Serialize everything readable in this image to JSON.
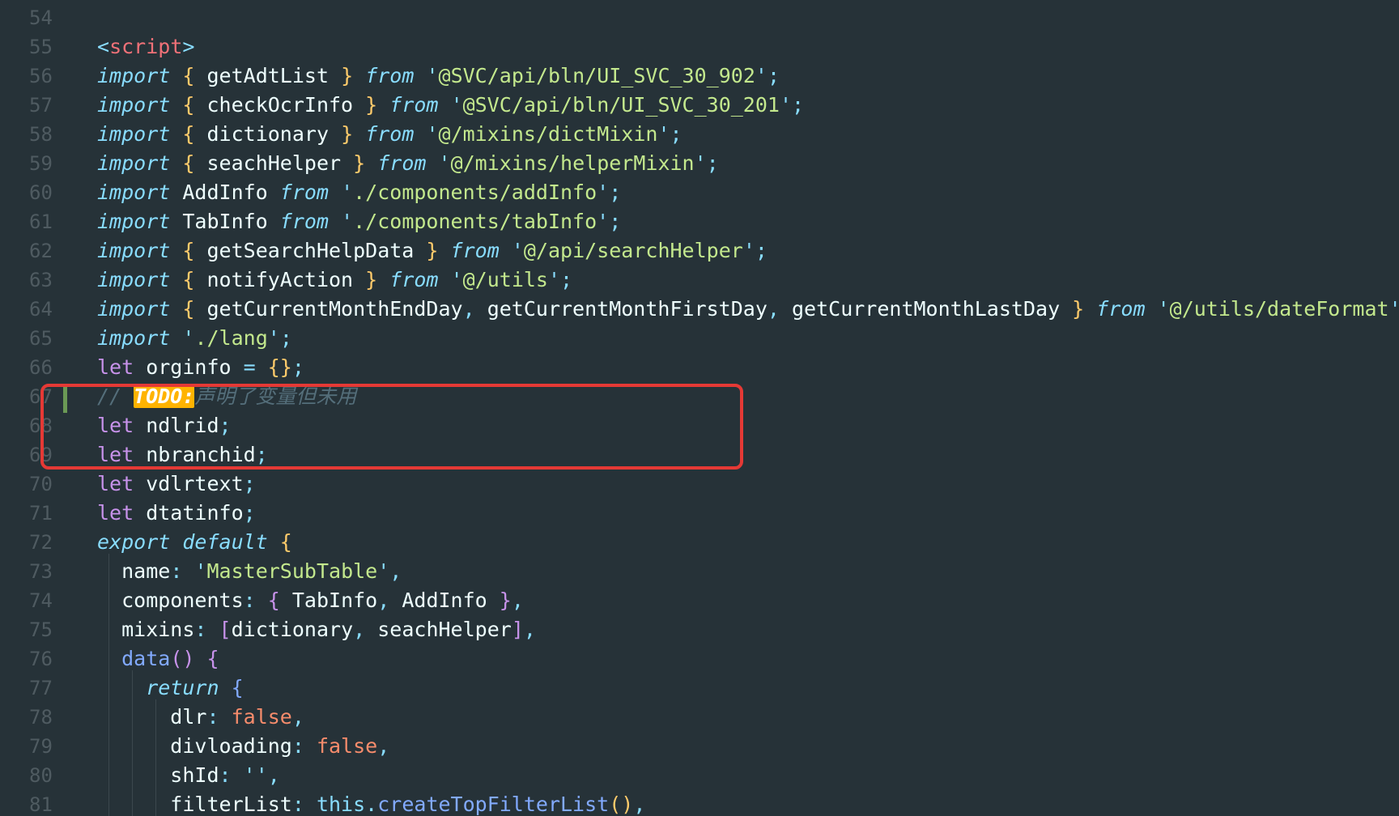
{
  "editor": {
    "lines": [
      {
        "n": "54",
        "tokens": []
      },
      {
        "n": "55",
        "tokens": [
          {
            "t": "<",
            "c": "tok-tagbr"
          },
          {
            "t": "script",
            "c": "tok-tag"
          },
          {
            "t": ">",
            "c": "tok-tagbr"
          }
        ]
      },
      {
        "n": "56",
        "tokens": [
          {
            "t": "import",
            "c": "tok-kw-italic"
          },
          {
            "t": " ",
            "c": ""
          },
          {
            "t": "{",
            "c": "tok-brace"
          },
          {
            "t": " getAdtList ",
            "c": "tok-ident"
          },
          {
            "t": "}",
            "c": "tok-brace"
          },
          {
            "t": " ",
            "c": ""
          },
          {
            "t": "from",
            "c": "tok-kw-italic"
          },
          {
            "t": " ",
            "c": ""
          },
          {
            "t": "'",
            "c": "tok-punct"
          },
          {
            "t": "@SVC/api/bln/UI_SVC_30_902",
            "c": "tok-str"
          },
          {
            "t": "'",
            "c": "tok-punct"
          },
          {
            "t": ";",
            "c": "tok-punct"
          }
        ]
      },
      {
        "n": "57",
        "tokens": [
          {
            "t": "import",
            "c": "tok-kw-italic"
          },
          {
            "t": " ",
            "c": ""
          },
          {
            "t": "{",
            "c": "tok-brace"
          },
          {
            "t": " checkOcrInfo ",
            "c": "tok-ident"
          },
          {
            "t": "}",
            "c": "tok-brace"
          },
          {
            "t": " ",
            "c": ""
          },
          {
            "t": "from",
            "c": "tok-kw-italic"
          },
          {
            "t": " ",
            "c": ""
          },
          {
            "t": "'",
            "c": "tok-punct"
          },
          {
            "t": "@SVC/api/bln/UI_SVC_30_201",
            "c": "tok-str"
          },
          {
            "t": "'",
            "c": "tok-punct"
          },
          {
            "t": ";",
            "c": "tok-punct"
          }
        ]
      },
      {
        "n": "58",
        "tokens": [
          {
            "t": "import",
            "c": "tok-kw-italic"
          },
          {
            "t": " ",
            "c": ""
          },
          {
            "t": "{",
            "c": "tok-brace"
          },
          {
            "t": " dictionary ",
            "c": "tok-ident"
          },
          {
            "t": "}",
            "c": "tok-brace"
          },
          {
            "t": " ",
            "c": ""
          },
          {
            "t": "from",
            "c": "tok-kw-italic"
          },
          {
            "t": " ",
            "c": ""
          },
          {
            "t": "'",
            "c": "tok-punct"
          },
          {
            "t": "@/mixins/dictMixin",
            "c": "tok-str"
          },
          {
            "t": "'",
            "c": "tok-punct"
          },
          {
            "t": ";",
            "c": "tok-punct"
          }
        ]
      },
      {
        "n": "59",
        "tokens": [
          {
            "t": "import",
            "c": "tok-kw-italic"
          },
          {
            "t": " ",
            "c": ""
          },
          {
            "t": "{",
            "c": "tok-brace"
          },
          {
            "t": " seachHelper ",
            "c": "tok-ident"
          },
          {
            "t": "}",
            "c": "tok-brace"
          },
          {
            "t": " ",
            "c": ""
          },
          {
            "t": "from",
            "c": "tok-kw-italic"
          },
          {
            "t": " ",
            "c": ""
          },
          {
            "t": "'",
            "c": "tok-punct"
          },
          {
            "t": "@/mixins/helperMixin",
            "c": "tok-str"
          },
          {
            "t": "'",
            "c": "tok-punct"
          },
          {
            "t": ";",
            "c": "tok-punct"
          }
        ]
      },
      {
        "n": "60",
        "tokens": [
          {
            "t": "import",
            "c": "tok-kw-italic"
          },
          {
            "t": " AddInfo ",
            "c": "tok-ident"
          },
          {
            "t": "from",
            "c": "tok-kw-italic"
          },
          {
            "t": " ",
            "c": ""
          },
          {
            "t": "'",
            "c": "tok-punct"
          },
          {
            "t": "./components/addInfo",
            "c": "tok-str"
          },
          {
            "t": "'",
            "c": "tok-punct"
          },
          {
            "t": ";",
            "c": "tok-punct"
          }
        ]
      },
      {
        "n": "61",
        "tokens": [
          {
            "t": "import",
            "c": "tok-kw-italic"
          },
          {
            "t": " TabInfo ",
            "c": "tok-ident"
          },
          {
            "t": "from",
            "c": "tok-kw-italic"
          },
          {
            "t": " ",
            "c": ""
          },
          {
            "t": "'",
            "c": "tok-punct"
          },
          {
            "t": "./components/tabInfo",
            "c": "tok-str"
          },
          {
            "t": "'",
            "c": "tok-punct"
          },
          {
            "t": ";",
            "c": "tok-punct"
          }
        ]
      },
      {
        "n": "62",
        "tokens": [
          {
            "t": "import",
            "c": "tok-kw-italic"
          },
          {
            "t": " ",
            "c": ""
          },
          {
            "t": "{",
            "c": "tok-brace"
          },
          {
            "t": " getSearchHelpData ",
            "c": "tok-ident"
          },
          {
            "t": "}",
            "c": "tok-brace"
          },
          {
            "t": " ",
            "c": ""
          },
          {
            "t": "from",
            "c": "tok-kw-italic"
          },
          {
            "t": " ",
            "c": ""
          },
          {
            "t": "'",
            "c": "tok-punct"
          },
          {
            "t": "@/api/searchHelper",
            "c": "tok-str"
          },
          {
            "t": "'",
            "c": "tok-punct"
          },
          {
            "t": ";",
            "c": "tok-punct"
          }
        ]
      },
      {
        "n": "63",
        "tokens": [
          {
            "t": "import",
            "c": "tok-kw-italic"
          },
          {
            "t": " ",
            "c": ""
          },
          {
            "t": "{",
            "c": "tok-brace"
          },
          {
            "t": " notifyAction ",
            "c": "tok-ident"
          },
          {
            "t": "}",
            "c": "tok-brace"
          },
          {
            "t": " ",
            "c": ""
          },
          {
            "t": "from",
            "c": "tok-kw-italic"
          },
          {
            "t": " ",
            "c": ""
          },
          {
            "t": "'",
            "c": "tok-punct"
          },
          {
            "t": "@/utils",
            "c": "tok-str"
          },
          {
            "t": "'",
            "c": "tok-punct"
          },
          {
            "t": ";",
            "c": "tok-punct"
          }
        ]
      },
      {
        "n": "64",
        "tokens": [
          {
            "t": "import",
            "c": "tok-kw-italic"
          },
          {
            "t": " ",
            "c": ""
          },
          {
            "t": "{",
            "c": "tok-brace"
          },
          {
            "t": " getCurrentMonthEndDay",
            "c": "tok-ident"
          },
          {
            "t": ",",
            "c": "tok-punct"
          },
          {
            "t": " getCurrentMonthFirstDay",
            "c": "tok-ident"
          },
          {
            "t": ",",
            "c": "tok-punct"
          },
          {
            "t": " getCurrentMonthLastDay ",
            "c": "tok-ident"
          },
          {
            "t": "}",
            "c": "tok-brace"
          },
          {
            "t": " ",
            "c": ""
          },
          {
            "t": "from",
            "c": "tok-kw-italic"
          },
          {
            "t": " ",
            "c": ""
          },
          {
            "t": "'",
            "c": "tok-punct"
          },
          {
            "t": "@/utils/dateFormat",
            "c": "tok-str"
          },
          {
            "t": "'",
            "c": "tok-punct"
          },
          {
            "t": ";",
            "c": "tok-punct"
          }
        ]
      },
      {
        "n": "65",
        "tokens": [
          {
            "t": "import",
            "c": "tok-kw-italic"
          },
          {
            "t": " ",
            "c": ""
          },
          {
            "t": "'",
            "c": "tok-punct"
          },
          {
            "t": "./lang",
            "c": "tok-str"
          },
          {
            "t": "'",
            "c": "tok-punct"
          },
          {
            "t": ";",
            "c": "tok-punct"
          }
        ]
      },
      {
        "n": "66",
        "tokens": [
          {
            "t": "let",
            "c": "tok-let"
          },
          {
            "t": " orginfo ",
            "c": "tok-ident"
          },
          {
            "t": "=",
            "c": "tok-punct"
          },
          {
            "t": " ",
            "c": ""
          },
          {
            "t": "{}",
            "c": "tok-brace"
          },
          {
            "t": ";",
            "c": "tok-punct"
          }
        ]
      },
      {
        "n": "67",
        "tokens": [
          {
            "t": "// ",
            "c": "tok-cmt"
          },
          {
            "t": "TODO:",
            "c": "tok-todo"
          },
          {
            "t": "声明了变量但未用",
            "c": "tok-cmt"
          }
        ]
      },
      {
        "n": "68",
        "tokens": [
          {
            "t": "let",
            "c": "tok-let"
          },
          {
            "t": " ndlrid",
            "c": "tok-ident"
          },
          {
            "t": ";",
            "c": "tok-punct"
          }
        ]
      },
      {
        "n": "69",
        "tokens": [
          {
            "t": "let",
            "c": "tok-let"
          },
          {
            "t": " nbranchid",
            "c": "tok-ident"
          },
          {
            "t": ";",
            "c": "tok-punct"
          }
        ]
      },
      {
        "n": "70",
        "tokens": [
          {
            "t": "let",
            "c": "tok-let"
          },
          {
            "t": " vdlrtext",
            "c": "tok-ident"
          },
          {
            "t": ";",
            "c": "tok-punct"
          }
        ]
      },
      {
        "n": "71",
        "tokens": [
          {
            "t": "let",
            "c": "tok-let"
          },
          {
            "t": " dtatinfo",
            "c": "tok-ident"
          },
          {
            "t": ";",
            "c": "tok-punct"
          }
        ]
      },
      {
        "n": "72",
        "tokens": [
          {
            "t": "export",
            "c": "tok-kw-italic"
          },
          {
            "t": " ",
            "c": ""
          },
          {
            "t": "default",
            "c": "tok-kw-italic"
          },
          {
            "t": " ",
            "c": ""
          },
          {
            "t": "{",
            "c": "tok-brace"
          }
        ]
      },
      {
        "n": "73",
        "tokens": [
          {
            "t": "  name",
            "c": "tok-prop"
          },
          {
            "t": ":",
            "c": "tok-punct"
          },
          {
            "t": " ",
            "c": ""
          },
          {
            "t": "'",
            "c": "tok-punct"
          },
          {
            "t": "MasterSubTable",
            "c": "tok-str"
          },
          {
            "t": "'",
            "c": "tok-punct"
          },
          {
            "t": ",",
            "c": "tok-punct"
          }
        ]
      },
      {
        "n": "74",
        "tokens": [
          {
            "t": "  components",
            "c": "tok-prop"
          },
          {
            "t": ":",
            "c": "tok-punct"
          },
          {
            "t": " ",
            "c": ""
          },
          {
            "t": "{",
            "c": "tok-brace2"
          },
          {
            "t": " TabInfo",
            "c": "tok-ident"
          },
          {
            "t": ",",
            "c": "tok-punct"
          },
          {
            "t": " AddInfo ",
            "c": "tok-ident"
          },
          {
            "t": "}",
            "c": "tok-brace2"
          },
          {
            "t": ",",
            "c": "tok-punct"
          }
        ]
      },
      {
        "n": "75",
        "tokens": [
          {
            "t": "  mixins",
            "c": "tok-prop"
          },
          {
            "t": ":",
            "c": "tok-punct"
          },
          {
            "t": " ",
            "c": ""
          },
          {
            "t": "[",
            "c": "tok-brace2"
          },
          {
            "t": "dictionary",
            "c": "tok-ident"
          },
          {
            "t": ",",
            "c": "tok-punct"
          },
          {
            "t": " seachHelper",
            "c": "tok-ident"
          },
          {
            "t": "]",
            "c": "tok-brace2"
          },
          {
            "t": ",",
            "c": "tok-punct"
          }
        ]
      },
      {
        "n": "76",
        "tokens": [
          {
            "t": "  ",
            "c": ""
          },
          {
            "t": "data",
            "c": "tok-func"
          },
          {
            "t": "()",
            "c": "tok-brace2"
          },
          {
            "t": " ",
            "c": ""
          },
          {
            "t": "{",
            "c": "tok-brace2"
          }
        ]
      },
      {
        "n": "77",
        "tokens": [
          {
            "t": "    ",
            "c": ""
          },
          {
            "t": "return",
            "c": "tok-kw-italic"
          },
          {
            "t": " ",
            "c": ""
          },
          {
            "t": "{",
            "c": "tok-brace3"
          }
        ]
      },
      {
        "n": "78",
        "tokens": [
          {
            "t": "      dlr",
            "c": "tok-prop"
          },
          {
            "t": ":",
            "c": "tok-punct"
          },
          {
            "t": " ",
            "c": ""
          },
          {
            "t": "false",
            "c": "tok-bool"
          },
          {
            "t": ",",
            "c": "tok-punct"
          }
        ]
      },
      {
        "n": "79",
        "tokens": [
          {
            "t": "      divloading",
            "c": "tok-prop"
          },
          {
            "t": ":",
            "c": "tok-punct"
          },
          {
            "t": " ",
            "c": ""
          },
          {
            "t": "false",
            "c": "tok-bool"
          },
          {
            "t": ",",
            "c": "tok-punct"
          }
        ]
      },
      {
        "n": "80",
        "tokens": [
          {
            "t": "      shId",
            "c": "tok-prop"
          },
          {
            "t": ":",
            "c": "tok-punct"
          },
          {
            "t": " ",
            "c": ""
          },
          {
            "t": "''",
            "c": "tok-punct"
          },
          {
            "t": ",",
            "c": "tok-punct"
          }
        ]
      },
      {
        "n": "81",
        "tokens": [
          {
            "t": "      filterList",
            "c": "tok-prop"
          },
          {
            "t": ":",
            "c": "tok-punct"
          },
          {
            "t": " ",
            "c": ""
          },
          {
            "t": "this",
            "c": "tok-this"
          },
          {
            "t": ".",
            "c": "tok-punct"
          },
          {
            "t": "createTopFilterList",
            "c": "tok-method"
          },
          {
            "t": "()",
            "c": "tok-brace"
          },
          {
            "t": ",",
            "c": "tok-punct"
          }
        ]
      }
    ]
  },
  "highlight": {
    "color": "#e53935",
    "first_line": "67",
    "last_line": "69"
  },
  "colors": {
    "background": "#263238",
    "line_number": "#4f5b61",
    "keyword": "#89ddff",
    "let": "#c792ea",
    "string": "#c3e88d",
    "brace": "#ffcb6b",
    "comment": "#546e7a",
    "todo_bg": "#ffb300",
    "boolean": "#f78c6c",
    "tag": "#f07178"
  }
}
